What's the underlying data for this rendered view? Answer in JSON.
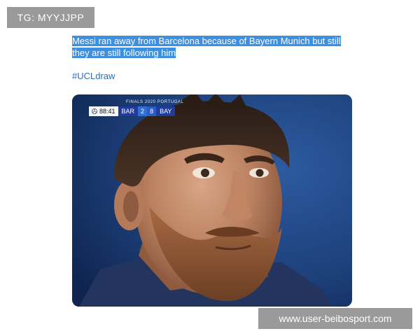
{
  "watermarks": {
    "top": "TG: MYYJJPP",
    "bottom": "www.user-beibosport.com"
  },
  "tweet": {
    "text": "Messi ran away from Barcelona because of Bayern Munich but still they are still following him",
    "hashtag": "#UCLdraw"
  },
  "media": {
    "scorebug": {
      "title": "FINALS 2020 PORTUGAL",
      "clock": "88:41",
      "home_team": "BAR",
      "home_score": "2",
      "away_score": "8",
      "away_team": "BAY",
      "colors": {
        "team_bg": "#1f3c9c",
        "score_bg": "#2f6fd6",
        "clock_bg": "#f4f6fa"
      }
    },
    "icons": [
      "champions-league-ball-icon"
    ]
  }
}
